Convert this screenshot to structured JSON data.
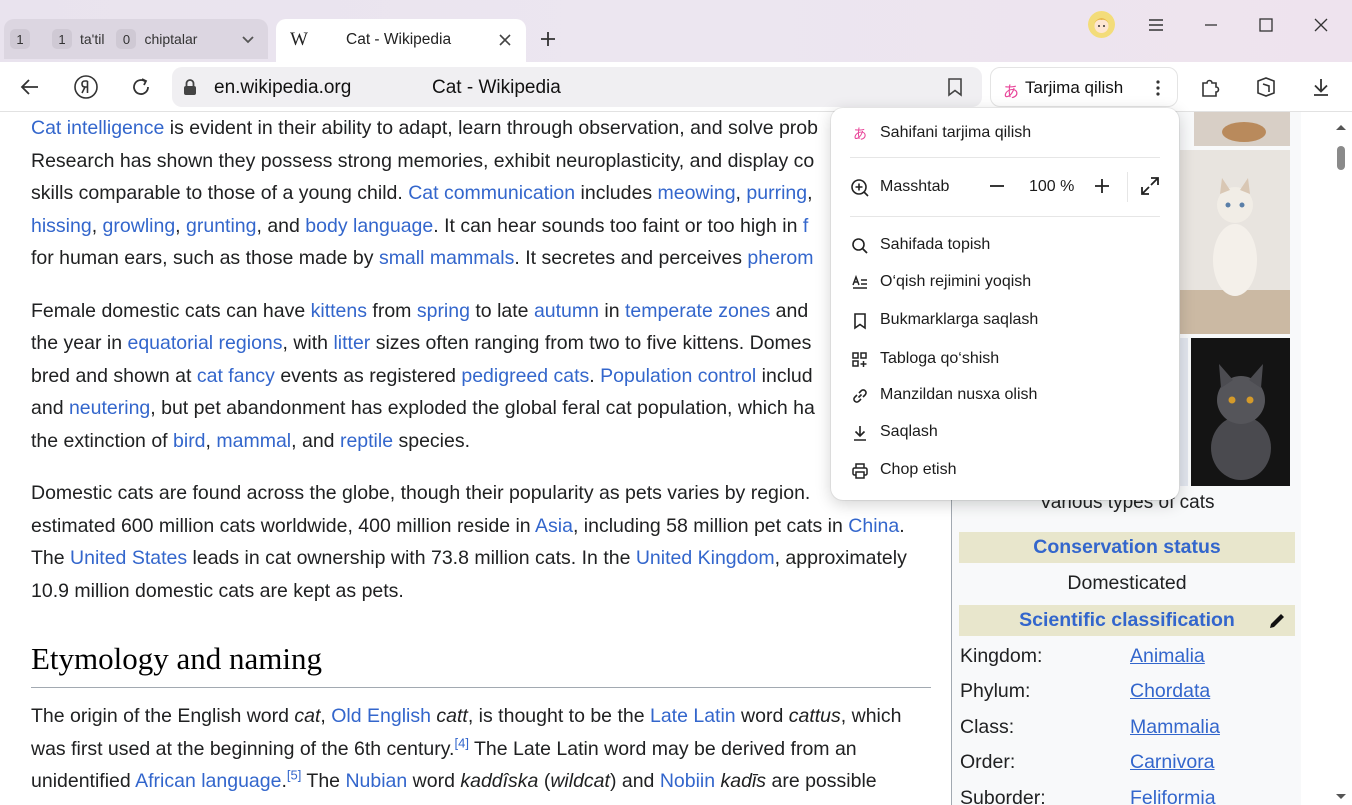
{
  "tabs": {
    "group": [
      {
        "count": "1",
        "label": ""
      },
      {
        "count": "1",
        "label": "ta'til"
      },
      {
        "count": "0",
        "label": "chiptalar"
      }
    ],
    "active": {
      "favicon": "W",
      "title": "Cat - Wikipedia"
    }
  },
  "address": {
    "domain": "en.wikipedia.org",
    "page_title": "Cat - Wikipedia"
  },
  "translate": {
    "icon": "あ",
    "label": "Tarjima qilish"
  },
  "menu": {
    "translate_icon": "あ",
    "translate_page": "Sahifani tarjima qilish",
    "zoom_label": "Masshtab",
    "zoom_value": "100 %",
    "find": "Sahifada topish",
    "reader": "O‘qish rejimini yoqish",
    "bookmark": "Bukmarklarga saqlash",
    "tableau": "Tabloga qo‘shish",
    "copy_link": "Manzildan nusxa olish",
    "save": "Saqlash",
    "print": "Chop etish"
  },
  "article": {
    "p1": {
      "l1": {
        "a1": "Cat intelligence",
        "t1": " is evident in their ability to adapt, learn through observation, and solve prob"
      },
      "l2": {
        "t1": "Research has shown they possess strong memories, exhibit neuroplasticity, and display co"
      },
      "l3": {
        "t1": "skills comparable to those of a young child. ",
        "a1": "Cat communication",
        "t2": " includes ",
        "a2": "meowing",
        "t3": ", ",
        "a3": "purring",
        "t4": ","
      },
      "l4": {
        "a1": "hissing",
        "t1": ", ",
        "a2": "growling",
        "t2": ", ",
        "a3": "grunting",
        "t3": ", and ",
        "a4": "body language",
        "t4": ". It can hear sounds too faint or too high in ",
        "a5": "f"
      },
      "l5": {
        "t1": "for human ears, such as those made by ",
        "a1": "small mammals",
        "t2": ". It secretes and perceives ",
        "a2": "pherom"
      }
    },
    "p2": {
      "l1": {
        "t1": "Female domestic cats can have ",
        "a1": "kittens",
        "t2": " from ",
        "a2": "spring",
        "t3": " to late ",
        "a3": "autumn",
        "t4": " in ",
        "a4": "temperate zones",
        "t5": " and "
      },
      "l2": {
        "t1": "the year in ",
        "a1": "equatorial regions",
        "t2": ", with ",
        "a2": "litter",
        "t3": " sizes often ranging from two to five kittens. Domes"
      },
      "l3": {
        "t1": "bred and shown at ",
        "a1": "cat fancy",
        "t2": " events as registered ",
        "a2": "pedigreed cats",
        "t3": ". ",
        "a3": "Population control",
        "t4": " includ"
      },
      "l4": {
        "t1": "and ",
        "a1": "neutering",
        "t2": ", but pet abandonment has exploded the global feral cat population, which ha"
      },
      "l5": {
        "t1": "the extinction of ",
        "a1": "bird",
        "t2": ", ",
        "a2": "mammal",
        "t3": ", and ",
        "a3": "reptile",
        "t4": " species."
      }
    },
    "p3": {
      "l1": {
        "t1": "Domestic cats are found across the globe, though their popularity as pets varies by region. "
      },
      "l2": {
        "t1": "estimated 600 million cats worldwide, 400 million reside in ",
        "a1": "Asia",
        "t2": ", including 58 million pet cats in ",
        "a2": "China",
        "t3": "."
      },
      "l3": {
        "t1": "The ",
        "a1": "United States",
        "t2": " leads in cat ownership with 73.8 million cats. In the ",
        "a2": "United Kingdom",
        "t3": ", approximately"
      },
      "l4": {
        "t1": "10.9 million domestic cats are kept as pets."
      }
    },
    "heading": "Etymology and naming",
    "p4": {
      "l1": {
        "t1": "The origin of the English word ",
        "i1": "cat",
        "t2": ", ",
        "a1": "Old English",
        "t3": " ",
        "i2": "catt",
        "t4": ", is thought to be the ",
        "a2": "Late Latin",
        "t5": " word ",
        "i3": "cattus",
        "t6": ", which"
      },
      "l2": {
        "t1": "was first used at the beginning of the 6th century.",
        "s1": "[4]",
        "t2": " The Late Latin word may be derived from an"
      },
      "l3": {
        "t1": "unidentified ",
        "a1": "African language",
        "t2": ".",
        "s1": "[5]",
        "t3": " The ",
        "a2": "Nubian",
        "t4": " word ",
        "i1": "kaddîska",
        "t5": " (",
        "i2": "wildcat",
        "t6": ") and ",
        "a3": "Nobiin",
        "t7": " ",
        "i3": "kadīs",
        "t8": " are possible"
      }
    }
  },
  "infobox": {
    "caption": "Various types of cats",
    "conservation_header": "Conservation status",
    "conservation_value": "Domesticated",
    "classification_header": "Scientific classification",
    "rows": [
      {
        "key": "Kingdom:",
        "value": "Animalia"
      },
      {
        "key": "Phylum:",
        "value": "Chordata"
      },
      {
        "key": "Class:",
        "value": "Mammalia"
      },
      {
        "key": "Order:",
        "value": "Carnivora"
      },
      {
        "key": "Suborder:",
        "value": "Feliformia"
      }
    ]
  },
  "colors": {
    "link": "#3366cc",
    "accent": "#e8479a",
    "infobox_header": "#e8e6cc"
  }
}
